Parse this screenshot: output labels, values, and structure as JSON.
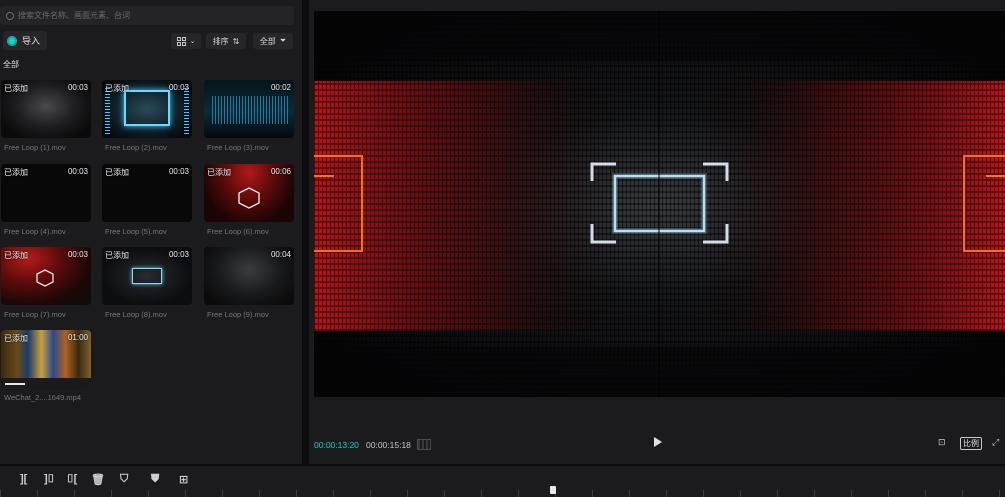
{
  "search": {
    "placeholder": "搜索文件名称、画面元素、台词"
  },
  "toolbar": {
    "import_label": "导入",
    "sort_label": "排序",
    "filter_label": "全部"
  },
  "section": {
    "label": "全部"
  },
  "media": [
    {
      "name": "Free Loop (1).mov",
      "status": "已添加",
      "duration": "00:03"
    },
    {
      "name": "Free Loop (2).mov",
      "status": "已添加",
      "duration": "00:03"
    },
    {
      "name": "Free Loop (3).mov",
      "status": "",
      "duration": "00:02"
    },
    {
      "name": "Free Loop (4).mov",
      "status": "已添加",
      "duration": "00:03"
    },
    {
      "name": "Free Loop (5).mov",
      "status": "已添加",
      "duration": "00:03"
    },
    {
      "name": "Free Loop (6).mov",
      "status": "已添加",
      "duration": "00:06"
    },
    {
      "name": "Free Loop (7).mov",
      "status": "已添加",
      "duration": "00:03"
    },
    {
      "name": "Free Loop (8).mov",
      "status": "已添加",
      "duration": "00:03"
    },
    {
      "name": "Free Loop (9).mov",
      "status": "",
      "duration": "00:04"
    },
    {
      "name": "WeChat_2....1649.mp4",
      "status": "已添加",
      "duration": "01:00"
    }
  ],
  "preview": {
    "current_time": "00:00:13:20",
    "total_time": "00:00:15:18",
    "ratio_label": "比例"
  },
  "colors": {
    "accent": "#1fd1c4",
    "panel": "#1b1b1e",
    "background": "#0d0d0f"
  },
  "icons": {
    "play": "play-icon",
    "fullscreen": "fullscreen-icon",
    "fit": "fit-screen-icon"
  }
}
